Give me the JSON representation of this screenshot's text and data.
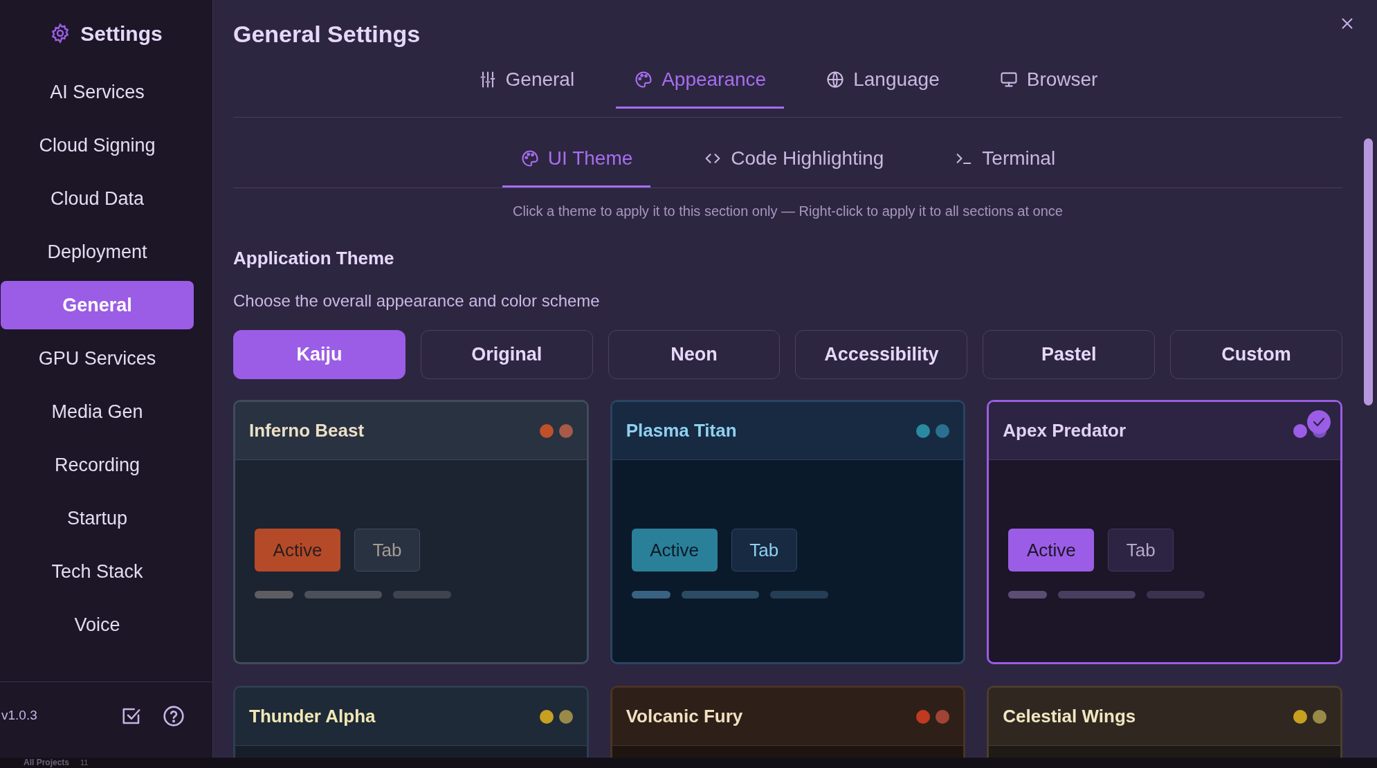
{
  "sidebar": {
    "title": "Settings",
    "items": [
      {
        "label": "AI Services",
        "selected": false
      },
      {
        "label": "Cloud Signing",
        "selected": false
      },
      {
        "label": "Cloud Data",
        "selected": false
      },
      {
        "label": "Deployment",
        "selected": false
      },
      {
        "label": "General",
        "selected": true
      },
      {
        "label": "GPU Services",
        "selected": false
      },
      {
        "label": "Media Gen",
        "selected": false
      },
      {
        "label": "Recording",
        "selected": false
      },
      {
        "label": "Startup",
        "selected": false
      },
      {
        "label": "Tech Stack",
        "selected": false
      },
      {
        "label": "Voice",
        "selected": false
      }
    ],
    "version": "v1.0.3"
  },
  "main": {
    "title": "General Settings",
    "tabs": [
      {
        "label": "General",
        "kind": "sliders",
        "selected": false
      },
      {
        "label": "Appearance",
        "kind": "palette",
        "selected": true
      },
      {
        "label": "Language",
        "kind": "globe",
        "selected": false
      },
      {
        "label": "Browser",
        "kind": "monitor",
        "selected": false
      }
    ],
    "subtabs": [
      {
        "label": "UI Theme",
        "kind": "palette",
        "selected": true
      },
      {
        "label": "Code Highlighting",
        "kind": "code",
        "selected": false
      },
      {
        "label": "Terminal",
        "kind": "terminal",
        "selected": false
      }
    ],
    "hint": "Click a theme to apply it to this section only — Right-click to apply it to all sections at once",
    "section_title": "Application Theme",
    "section_subtitle": "Choose the overall appearance and color scheme",
    "presets": [
      {
        "label": "Kaiju",
        "selected": true
      },
      {
        "label": "Original",
        "selected": false
      },
      {
        "label": "Neon",
        "selected": false
      },
      {
        "label": "Accessibility",
        "selected": false
      },
      {
        "label": "Pastel",
        "selected": false
      },
      {
        "label": "Custom",
        "selected": false
      }
    ],
    "themes": [
      {
        "name": "Inferno Beast",
        "selected": false,
        "dots": [
          {
            "color": "#c0502a"
          },
          {
            "color": "#a85a48"
          }
        ],
        "active_label": "Active",
        "tab_label": "Tab"
      },
      {
        "name": "Plasma Titan",
        "selected": false,
        "dots": [
          {
            "color": "#2a8aa0"
          },
          {
            "color": "#2a7090"
          }
        ],
        "active_label": "Active",
        "tab_label": "Tab"
      },
      {
        "name": "Apex Predator",
        "selected": true,
        "dots": [
          {
            "color": "#9b5de5"
          },
          {
            "color": "#7a50c0"
          }
        ],
        "active_label": "Active",
        "tab_label": "Tab"
      },
      {
        "name": "Thunder Alpha",
        "selected": false,
        "dots": [
          {
            "color": "#c8a020"
          },
          {
            "color": "#9a8a48"
          }
        ]
      },
      {
        "name": "Volcanic Fury",
        "selected": false,
        "dots": [
          {
            "color": "#c03a20"
          },
          {
            "color": "#a04438"
          }
        ]
      },
      {
        "name": "Celestial Wings",
        "selected": false,
        "dots": [
          {
            "color": "#c8a020"
          },
          {
            "color": "#9a8a48"
          }
        ]
      }
    ]
  },
  "background_window": {
    "label": "All Projects",
    "count": "11"
  }
}
